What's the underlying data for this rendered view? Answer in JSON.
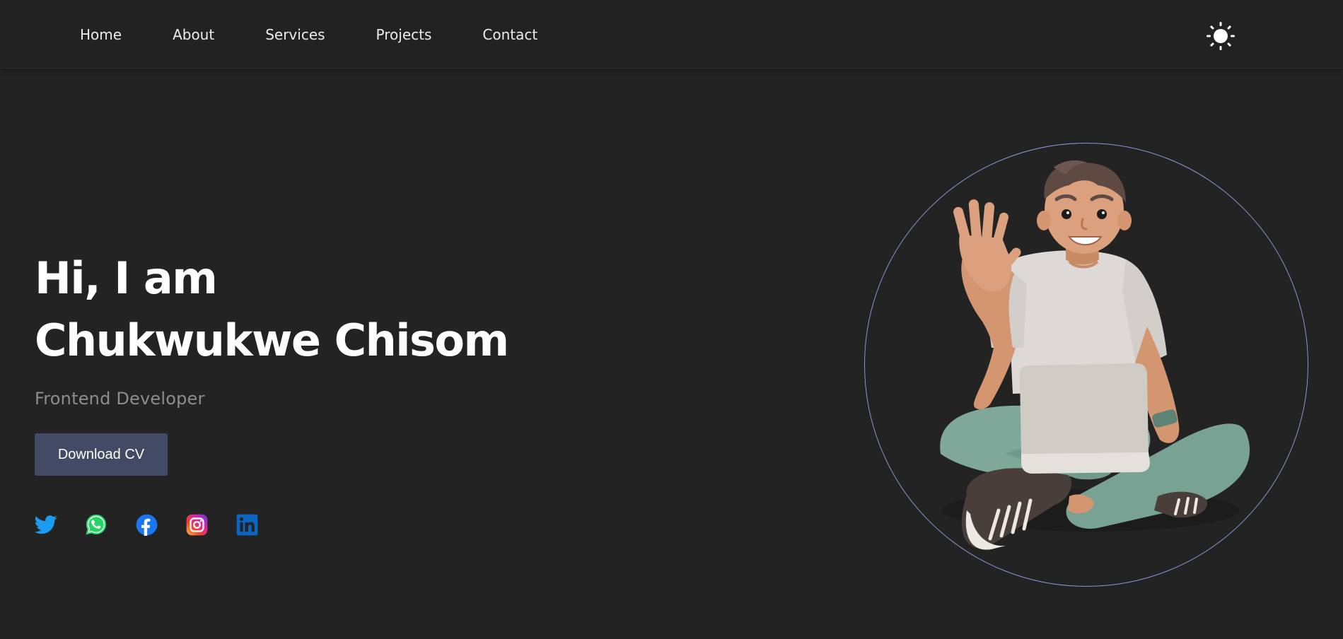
{
  "nav": {
    "items": [
      {
        "label": "Home"
      },
      {
        "label": "About"
      },
      {
        "label": "Services"
      },
      {
        "label": "Projects"
      },
      {
        "label": "Contact"
      }
    ],
    "theme_toggle_icon": "sun-icon"
  },
  "hero": {
    "greeting": "Hi, I am",
    "name": "Chukwukwe Chisom",
    "role": "Frontend Developer",
    "cv_button": "Download CV",
    "avatar_icon": "waving-developer-with-laptop-illustration"
  },
  "socials": [
    {
      "name": "twitter-icon",
      "color": "#1d9bf0"
    },
    {
      "name": "whatsapp-icon",
      "color": "#25d366"
    },
    {
      "name": "facebook-icon",
      "color": "#1877f2"
    },
    {
      "name": "instagram-icon",
      "color": "#d6249f"
    },
    {
      "name": "linkedin-icon",
      "color": "#0a66c2"
    }
  ],
  "colors": {
    "background": "#232323",
    "navbar": "#222222",
    "accent_button": "#434a66",
    "ring": "#8a94d6",
    "subtitle": "#8d8d8d"
  }
}
